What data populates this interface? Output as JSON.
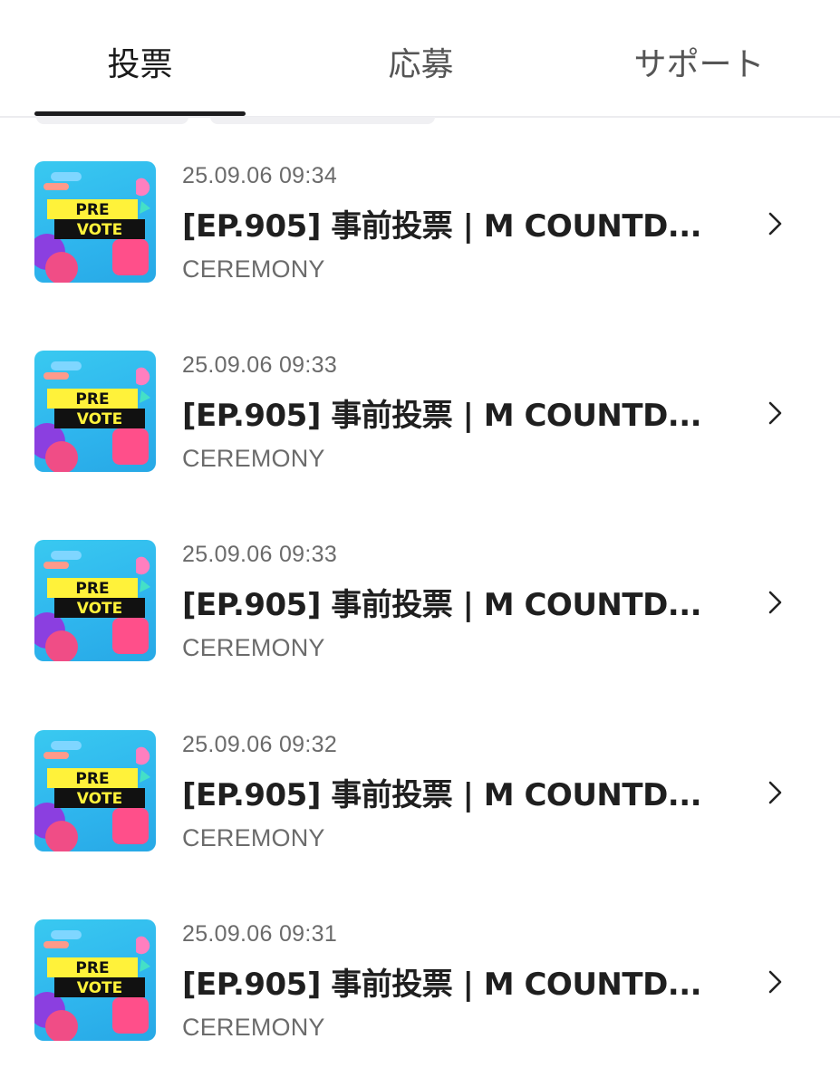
{
  "tabs": [
    {
      "label": "投票",
      "active": true
    },
    {
      "label": "応募",
      "active": false
    },
    {
      "label": "サポート",
      "active": false
    }
  ],
  "thumbnail": {
    "line1": "PRE",
    "line2": "VOTE"
  },
  "items": [
    {
      "date": "25.09.06 09:34",
      "title": "[EP.905] 事前投票 | M COUNTD...",
      "channel": "CEREMONY"
    },
    {
      "date": "25.09.06 09:33",
      "title": "[EP.905] 事前投票 | M COUNTD...",
      "channel": "CEREMONY"
    },
    {
      "date": "25.09.06 09:33",
      "title": "[EP.905] 事前投票 | M COUNTD...",
      "channel": "CEREMONY"
    },
    {
      "date": "25.09.06 09:32",
      "title": "[EP.905] 事前投票 | M COUNTD...",
      "channel": "CEREMONY"
    },
    {
      "date": "25.09.06 09:31",
      "title": "[EP.905] 事前投票 | M COUNTD...",
      "channel": "CEREMONY"
    }
  ],
  "colors": {
    "active_tab_text": "#1a1a1a",
    "inactive_tab_text": "#555555",
    "underline": "#1c1c1e",
    "title_text": "#1f1f1f",
    "meta_text": "#6b6b6b",
    "thumb_bg": "#2fb6ee",
    "thumb_band_yellow": "#fff23a",
    "thumb_band_black": "#111111"
  },
  "icons": {
    "row_arrow": "chevron-right-icon"
  }
}
